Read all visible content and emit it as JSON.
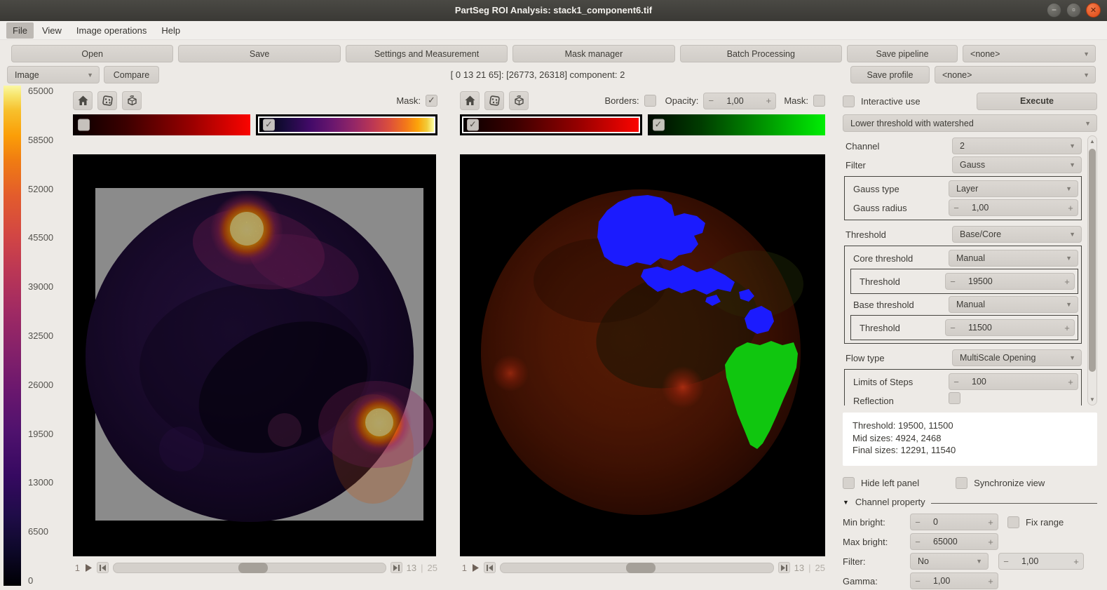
{
  "window": {
    "title": "PartSeg ROI Analysis: stack1_component6.tif"
  },
  "menu": {
    "items": [
      {
        "label": "File"
      },
      {
        "label": "View"
      },
      {
        "label": "Image operations"
      },
      {
        "label": "Help"
      }
    ]
  },
  "toolbar": {
    "open": "Open",
    "save": "Save",
    "settings_measurement": "Settings and Measurement",
    "mask_manager": "Mask manager",
    "batch_processing": "Batch Processing",
    "save_pipeline": "Save pipeline",
    "pipeline_select": "<none>",
    "image_select": "Image",
    "compare": "Compare",
    "position_info": "[ 0 13 21 65]: [26773, 26318] component: 2",
    "save_profile": "Save profile",
    "profile_select": "<none>"
  },
  "colorbar": {
    "ticks": [
      "65000",
      "58500",
      "52000",
      "45500",
      "39000",
      "32500",
      "26000",
      "19500",
      "13000",
      "6500",
      "0"
    ]
  },
  "left_viewer": {
    "mask_label": "Mask:",
    "nav": {
      "start": "1",
      "current": "13",
      "separator": "|",
      "total": "25"
    }
  },
  "right_viewer": {
    "borders_label": "Borders:",
    "opacity_label": "Opacity:",
    "opacity_value": "1,00",
    "mask_label": "Mask:",
    "nav": {
      "start": "1",
      "current": "13",
      "separator": "|",
      "total": "25"
    }
  },
  "settings": {
    "interactive_label": "Interactive use",
    "execute_label": "Execute",
    "algorithm": "Lower threshold with watershed",
    "channel_label": "Channel",
    "channel_value": "2",
    "filter_label": "Filter",
    "filter_value": "Gauss",
    "gauss_type_label": "Gauss type",
    "gauss_type_value": "Layer",
    "gauss_radius_label": "Gauss radius",
    "gauss_radius_value": "1,00",
    "threshold_mode_label": "Threshold",
    "threshold_mode_value": "Base/Core",
    "core_threshold_label": "Core threshold",
    "core_threshold_value": "Manual",
    "core_threshold_spin_label": "Threshold",
    "core_threshold_spin_value": "19500",
    "base_threshold_label": "Base threshold",
    "base_threshold_value": "Manual",
    "base_threshold_spin_label": "Threshold",
    "base_threshold_spin_value": "11500",
    "flow_type_label": "Flow type",
    "flow_type_value": "MultiScale Opening",
    "steps_label": "Limits of Steps",
    "steps_value": "100",
    "clipped_label": "Reflection",
    "info_lines": [
      "Threshold: 19500, 11500",
      "Mid sizes: 4924, 2468",
      "Final sizes: 12291, 11540"
    ]
  },
  "bottom_panel": {
    "hide_left": "Hide left panel",
    "sync_view": "Synchronize view",
    "channel_property": "Channel property",
    "min_bright_label": "Min bright:",
    "min_bright_value": "0",
    "fix_range": "Fix range",
    "max_bright_label": "Max bright:",
    "max_bright_value": "65000",
    "filter_label": "Filter:",
    "filter_value": "No",
    "filter_spin_value": "1,00",
    "gamma_label": "Gamma:",
    "gamma_value": "1,00"
  },
  "colors": {
    "close_button": "#dd4814",
    "roi_blue": "#1b1bfe",
    "roi_green": "#10c60f",
    "mask_gray": "#8b8b8b",
    "selection_border": "#000000"
  }
}
